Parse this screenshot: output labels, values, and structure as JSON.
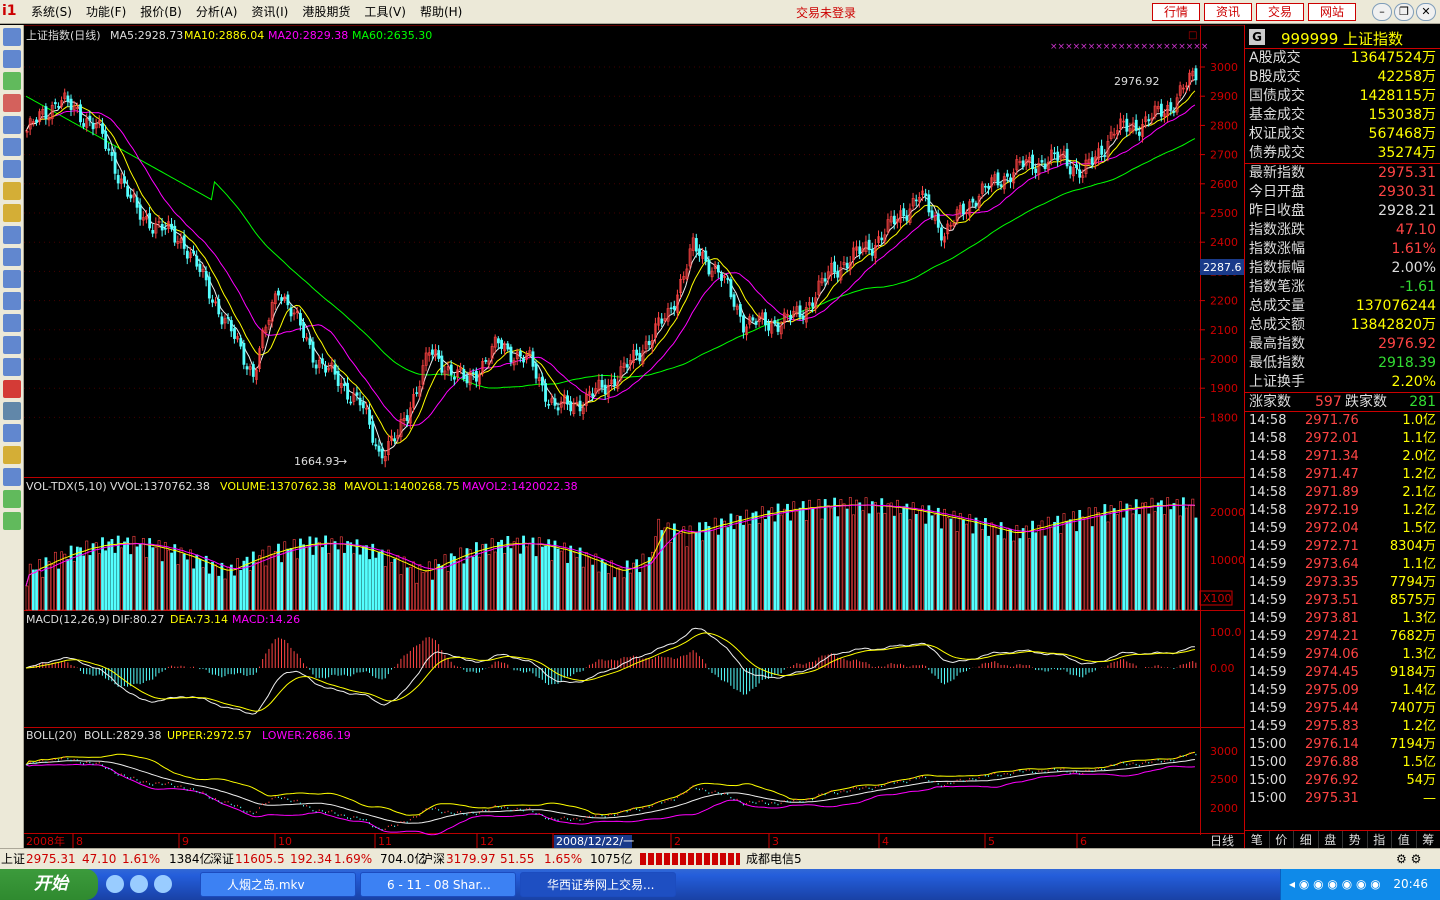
{
  "menubar": {
    "logo": "i1",
    "menus": [
      "系统(S)",
      "功能(F)",
      "报价(B)",
      "分析(A)",
      "资讯(I)",
      "港股期货",
      "工具(V)",
      "帮助(H)"
    ],
    "title": "交易未登录",
    "tabs": [
      "行情",
      "资讯",
      "交易",
      "网站"
    ],
    "window_controls": [
      "minimize-icon",
      "restore-icon",
      "close-icon"
    ]
  },
  "chart": {
    "main_header": {
      "name": "上证指数(日线)",
      "ma5": "MA5:2928.73",
      "ma10": "MA10:2886.04",
      "ma20": "MA20:2829.38",
      "ma60": "MA60:2635.30"
    },
    "price_axis": [
      "3000",
      "2900",
      "2800",
      "2700",
      "2600",
      "2500",
      "2400",
      "2300",
      "2200",
      "2100",
      "2000",
      "1900",
      "1800"
    ],
    "current_marker": "2287.6",
    "high_label": "2976.92",
    "low_label": "1664.93",
    "vol_header": {
      "name": "VOL-TDX(5,10)",
      "vvol": "VVOL:1370762.38",
      "volume": "VOLUME:1370762.38",
      "mavol1": "MAVOL1:1400268.75",
      "mavol2": "MAVOL2:1420022.38"
    },
    "vol_axis": [
      "20000",
      "10000"
    ],
    "vol_unit": "X100",
    "macd_header": {
      "name": "MACD(12,26,9)",
      "dif": "DIF:80.27",
      "dea": "DEA:73.14",
      "macd": "MACD:14.26"
    },
    "macd_axis": [
      "100.0",
      "0.00"
    ],
    "boll_header": {
      "name": "BOLL(20)",
      "boll": "BOLL:2829.38",
      "upper": "UPPER:2972.57",
      "lower": "LOWER:2686.19"
    },
    "boll_axis": [
      "3000",
      "2500",
      "2000"
    ],
    "date_axis": [
      "2008年",
      "8",
      "9",
      "10",
      "11",
      "12",
      "2008/12/22/一",
      "2",
      "3",
      "4",
      "5",
      "6"
    ],
    "period": "日线"
  },
  "right_panel": {
    "code": "999999",
    "name": "上证指数",
    "turnover": [
      {
        "label": "A股成交",
        "value": "13647524万"
      },
      {
        "label": "B股成交",
        "value": "42258万"
      },
      {
        "label": "国债成交",
        "value": "1428115万"
      },
      {
        "label": "基金成交",
        "value": "153038万"
      },
      {
        "label": "权证成交",
        "value": "567468万"
      },
      {
        "label": "债券成交",
        "value": "35274万"
      }
    ],
    "stats": [
      {
        "label": "最新指数",
        "value": "2975.31",
        "color": "#ff4444"
      },
      {
        "label": "今日开盘",
        "value": "2930.31",
        "color": "#ff4444"
      },
      {
        "label": "昨日收盘",
        "value": "2928.21",
        "color": "#dddddd"
      },
      {
        "label": "指数涨跌",
        "value": "47.10",
        "color": "#ff4444"
      },
      {
        "label": "指数涨幅",
        "value": "1.61%",
        "color": "#ff4444"
      },
      {
        "label": "指数振幅",
        "value": "2.00%",
        "color": "#dddddd"
      },
      {
        "label": "指数笔涨",
        "value": "-1.61",
        "color": "#33dd33"
      },
      {
        "label": "总成交量",
        "value": "137076244",
        "color": "#ffff00"
      },
      {
        "label": "总成交额",
        "value": "13842820万",
        "color": "#ffff00"
      },
      {
        "label": "最高指数",
        "value": "2976.92",
        "color": "#ff4444"
      },
      {
        "label": "最低指数",
        "value": "2918.39",
        "color": "#33dd33"
      },
      {
        "label": "上证换手",
        "value": "2.20%",
        "color": "#ffff00"
      }
    ],
    "updown": {
      "up_label": "涨家数",
      "up": "597",
      "down_label": "跌家数",
      "down": "281"
    },
    "ticks": [
      {
        "t": "14:58",
        "p": "2971.76",
        "q": "1.0亿"
      },
      {
        "t": "14:58",
        "p": "2972.01",
        "q": "1.1亿"
      },
      {
        "t": "14:58",
        "p": "2971.34",
        "q": "2.0亿"
      },
      {
        "t": "14:58",
        "p": "2971.47",
        "q": "1.2亿"
      },
      {
        "t": "14:58",
        "p": "2971.89",
        "q": "2.1亿"
      },
      {
        "t": "14:58",
        "p": "2972.19",
        "q": "1.2亿"
      },
      {
        "t": "14:59",
        "p": "2972.04",
        "q": "1.5亿"
      },
      {
        "t": "14:59",
        "p": "2972.71",
        "q": "8304万"
      },
      {
        "t": "14:59",
        "p": "2973.64",
        "q": "1.1亿"
      },
      {
        "t": "14:59",
        "p": "2973.35",
        "q": "7794万"
      },
      {
        "t": "14:59",
        "p": "2973.51",
        "q": "8575万"
      },
      {
        "t": "14:59",
        "p": "2973.81",
        "q": "1.3亿"
      },
      {
        "t": "14:59",
        "p": "2974.21",
        "q": "7682万"
      },
      {
        "t": "14:59",
        "p": "2974.06",
        "q": "1.3亿"
      },
      {
        "t": "14:59",
        "p": "2974.45",
        "q": "9184万"
      },
      {
        "t": "14:59",
        "p": "2975.09",
        "q": "1.4亿"
      },
      {
        "t": "14:59",
        "p": "2975.44",
        "q": "7407万"
      },
      {
        "t": "14:59",
        "p": "2975.83",
        "q": "1.2亿"
      },
      {
        "t": "15:00",
        "p": "2976.14",
        "q": "7194万"
      },
      {
        "t": "15:00",
        "p": "2976.88",
        "q": "1.5亿"
      },
      {
        "t": "15:00",
        "p": "2976.92",
        "q": "54万"
      },
      {
        "t": "15:00",
        "p": "2975.31",
        "q": "—"
      }
    ],
    "bottom_tabs": [
      "笔",
      "价",
      "细",
      "盘",
      "势",
      "指",
      "值",
      "筹"
    ]
  },
  "statusbar": {
    "sh_label": "上证",
    "sh_price": "2975.31",
    "sh_chg": "47.10",
    "sh_pct": "1.61%",
    "sh_amt": "1384亿",
    "sz_label": "深证",
    "sz_price": "11605.5",
    "sz_chg": "192.34",
    "sz_pct": "1.69%",
    "sz_amt": "704.0亿",
    "hs_label": "沪深",
    "hs_price": "3179.97",
    "hs_chg": "51.55",
    "hs_pct": "1.65%",
    "hs_amt": "1075亿",
    "server": "成都电信5"
  },
  "taskbar": {
    "start": "开始",
    "tasks": [
      "人烟之岛.mkv",
      "6 - 11 - 08 Shar...",
      "华西证券网上交易..."
    ],
    "clock": "20:46"
  }
}
